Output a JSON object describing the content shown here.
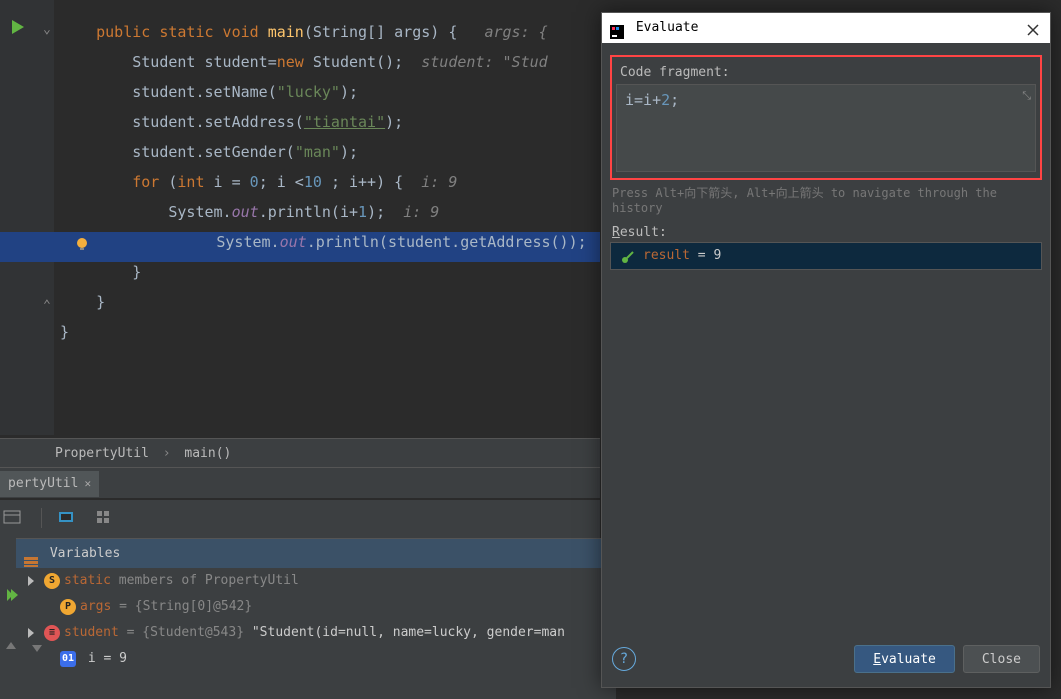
{
  "code": {
    "l1_pre": "    public static void ",
    "l1_main": "main",
    "l1_post": "(String[] args) {   ",
    "l1_cmt": "args: {",
    "l2": "        Student student=",
    "l2_new": "new ",
    "l2_post": "Student();  ",
    "l2_cmt": "student: \"Stud",
    "l3a": "        student.setName(",
    "l3s": "\"lucky\"",
    "l3b": ");",
    "l4a": "        student.setAddress(",
    "l4s": "\"tiantai\"",
    "l4b": ");",
    "l5a": "        student.setGender(",
    "l5s": "\"man\"",
    "l5b": ");",
    "l6a": "        for ",
    "l6b": "(int ",
    "l6c": "i = ",
    "l6n0": "0",
    "l6d": "; i <",
    "l6n10": "10 ",
    "l6e": "; i++) {  ",
    "l6cmt": "i: 9",
    "l7a": "            System.",
    "l7out": "out",
    "l7b": ".println(i+",
    "l7n": "1",
    "l7c": ");  ",
    "l7cmt": "i: 9",
    "l8a": "            System.",
    "l8out": "out",
    "l8b": ".println(student.getAddress());",
    "l9": "        }",
    "l10": "    }",
    "l11": "}"
  },
  "breadcrumb": {
    "a": "PropertyUtil",
    "b": "main()"
  },
  "tab": {
    "name": "pertyUtil"
  },
  "variables": {
    "header": "Variables",
    "r1_pre": "static ",
    "r1_post": "members of PropertyUtil",
    "r2_name": "args",
    "r2_val": " = {String[0]@542}",
    "r3_name": "student",
    "r3_val": " = {Student@543} ",
    "r3_str": "\"Student(id=null, name=lucky, gender=man",
    "r4_name": " i = 9"
  },
  "dialog": {
    "title": "Evaluate",
    "frag_label": "Code fragment:",
    "frag_text_a": "i=i+",
    "frag_text_n": "2",
    "frag_text_b": ";",
    "hint": "Press Alt+向下箭头, Alt+向上箭头 to navigate through the history",
    "result_label_u": "R",
    "result_label": "esult:",
    "result_name": " result",
    "result_val": " = 9",
    "btn_eval_u": "E",
    "btn_eval": "valuate",
    "btn_close": "Close"
  }
}
